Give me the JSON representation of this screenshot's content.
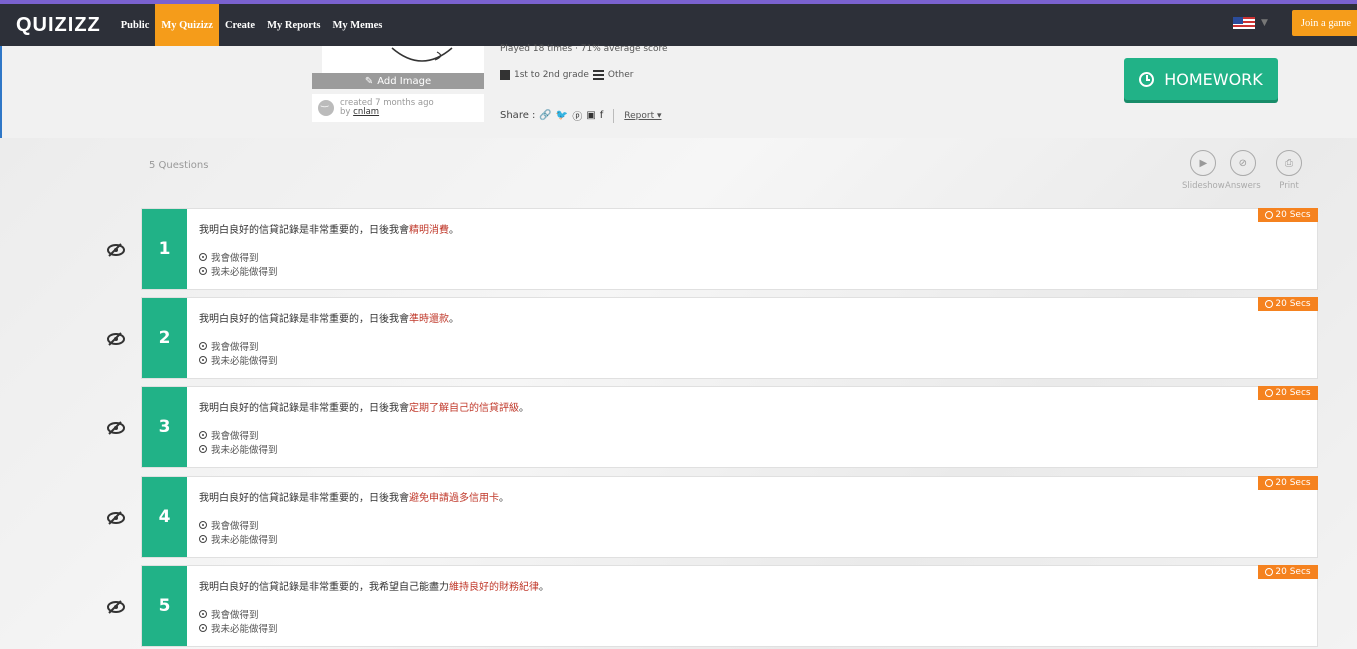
{
  "nav": {
    "logo": "QUIZIZZ",
    "items": [
      "Public",
      "My Quizizz",
      "Create",
      "My Reports",
      "My Memes"
    ],
    "active_index": 1,
    "join_label": "Join a game",
    "flag": "us-flag"
  },
  "quiz_header": {
    "add_image_label": "Add Image",
    "created_text": "created 7 months ago",
    "by_prefix": "by",
    "author": "cnlam",
    "played_text": "Played 18 times · 71% average score",
    "grade_text": "1st to 2nd grade",
    "subject_text": "Other",
    "share_label": "Share :",
    "report_label": "Report ▾",
    "homework_label": "HOMEWORK"
  },
  "questions_meta": {
    "count_label": "5 Questions",
    "tools": [
      "Slideshow",
      "Answers",
      "Print"
    ]
  },
  "questions": [
    {
      "num": "1",
      "prefix": "我明白良好的信貸記錄是非常重要的，日後我會",
      "highlight": "精明消費",
      "suffix": "。",
      "options": [
        "我會做得到",
        "我未必能做得到"
      ],
      "timer": "20 Secs"
    },
    {
      "num": "2",
      "prefix": "我明白良好的信貸記錄是非常重要的，日後我會",
      "highlight": "準時還款",
      "suffix": "。",
      "options": [
        "我會做得到",
        "我未必能做得到"
      ],
      "timer": "20 Secs"
    },
    {
      "num": "3",
      "prefix": "我明白良好的信貸記錄是非常重要的，日後我會",
      "highlight": "定期了解自己的信貸評級",
      "suffix": "。",
      "options": [
        "我會做得到",
        "我未必能做得到"
      ],
      "timer": "20 Secs"
    },
    {
      "num": "4",
      "prefix": "我明白良好的信貸記錄是非常重要的，日後我會",
      "highlight": "避免申請過多信用卡",
      "suffix": "。",
      "options": [
        "我會做得到",
        "我未必能做得到"
      ],
      "timer": "20 Secs"
    },
    {
      "num": "5",
      "prefix": "我明白良好的信貸記錄是非常重要的，我希望自己能盡力",
      "highlight": "維持良好的財務紀律",
      "suffix": "。",
      "options": [
        "我會做得到",
        "我未必能做得到"
      ],
      "timer": "20 Secs"
    }
  ],
  "colors": {
    "navbar": "#2d3039",
    "accent_orange": "#f59c1a",
    "green": "#21b287",
    "timer_orange": "#f5821f",
    "highlight_red": "#c0392b"
  }
}
